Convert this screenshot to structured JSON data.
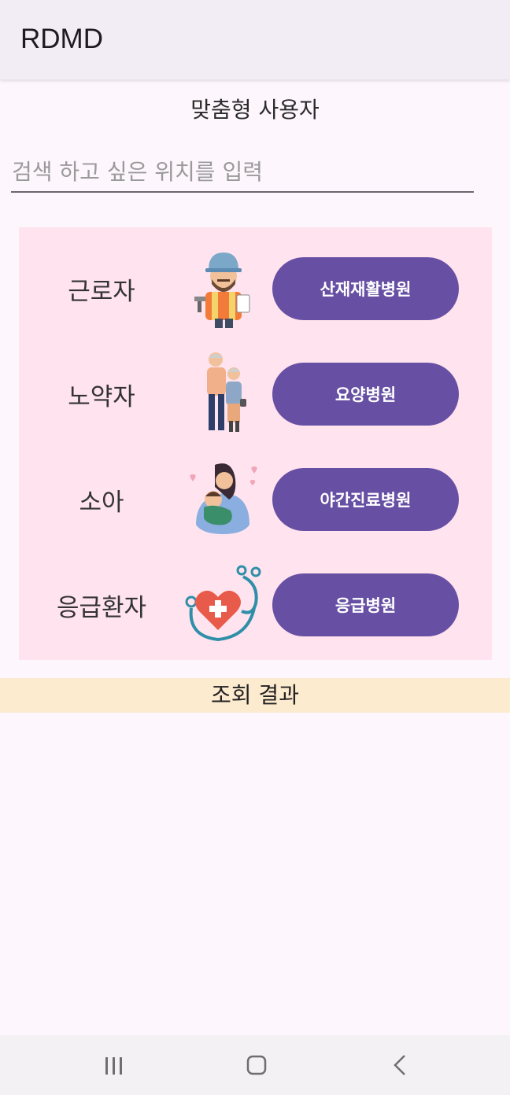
{
  "app": {
    "title": "RDMD"
  },
  "page": {
    "subtitle": "맞춤형 사용자"
  },
  "search": {
    "placeholder": "검색 하고 싶은 위치를 입력",
    "value": ""
  },
  "categories": [
    {
      "label": "근로자",
      "button": "산재재활병원",
      "icon": "construction-worker-icon"
    },
    {
      "label": "노약자",
      "button": "요양병원",
      "icon": "elderly-couple-icon"
    },
    {
      "label": "소아",
      "button": "야간진료병원",
      "icon": "mother-child-icon"
    },
    {
      "label": "응급환자",
      "button": "응급병원",
      "icon": "heart-stethoscope-icon"
    }
  ],
  "results": {
    "title": "조회 결과"
  },
  "nav": {
    "recents": "recent-apps-icon",
    "home": "home-icon",
    "back": "back-icon"
  },
  "colors": {
    "accent": "#6750a4",
    "panel": "#ffe3ee",
    "result_bar": "#fdebcf",
    "app_bar": "#f2ecf5"
  }
}
